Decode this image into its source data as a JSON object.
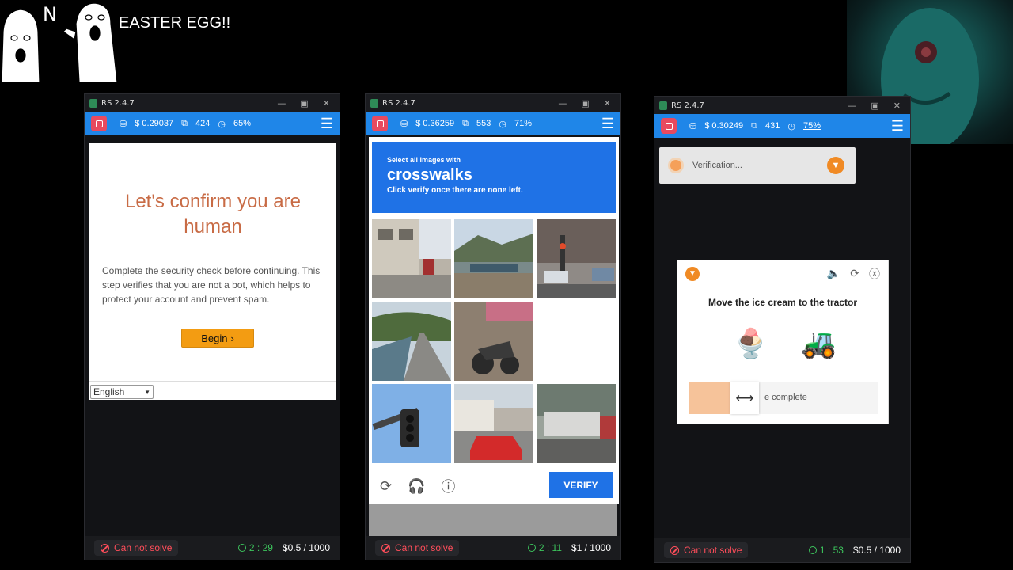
{
  "overlay": {
    "meme_letter": "N",
    "caption": "EASTER EGG!!"
  },
  "colors": {
    "status_bar": "#1f86e8",
    "stop_button": "#e84a5f",
    "captcha_blue": "#1f72e6",
    "begin_button": "#f39c12",
    "error_red": "#ff4d5a",
    "timer_green": "#3cc35c"
  },
  "windows": [
    {
      "title": "RS 2.4.7",
      "balance": "$ 0.29037",
      "tasks": "424",
      "rate": "65%",
      "cannot_solve": "Can not solve",
      "timer": "2 : 29",
      "price": "$0.5 / 1000",
      "content": {
        "heading": "Let's confirm you are human",
        "body": "Complete the security check before continuing. This step verifies that you are not a bot, which helps to protect your account and prevent spam.",
        "begin_label": "Begin",
        "language": "English"
      }
    },
    {
      "title": "RS 2.4.7",
      "balance": "$ 0.36259",
      "tasks": "553",
      "rate": "71%",
      "cannot_solve": "Can not solve",
      "timer": "2 : 11",
      "price": "$1 / 1000",
      "content": {
        "prompt_small": "Select all images with",
        "prompt_target": "crosswalks",
        "prompt_hint": "Click verify once there are none left.",
        "verify_label": "VERIFY",
        "tiles": [
          "street-house-scooter",
          "train-tracks-mountain",
          "intersection-traffic-light",
          "bridge-road",
          "motorbike-indoor",
          "empty-tile",
          "traffic-light-sky",
          "red-car-street",
          "bus-street"
        ]
      }
    },
    {
      "title": "RS 2.4.7",
      "balance": "$ 0.30249",
      "tasks": "431",
      "rate": "75%",
      "cannot_solve": "Can not solve",
      "timer": "1 : 53",
      "price": "$0.5 / 1000",
      "content": {
        "verification_text": "Verification...",
        "question": "Move the ice cream to the tractor",
        "drag_item": "🍨",
        "target_item": "🚜",
        "slider_text": "e complete",
        "slider_progress": 0.22
      }
    }
  ]
}
